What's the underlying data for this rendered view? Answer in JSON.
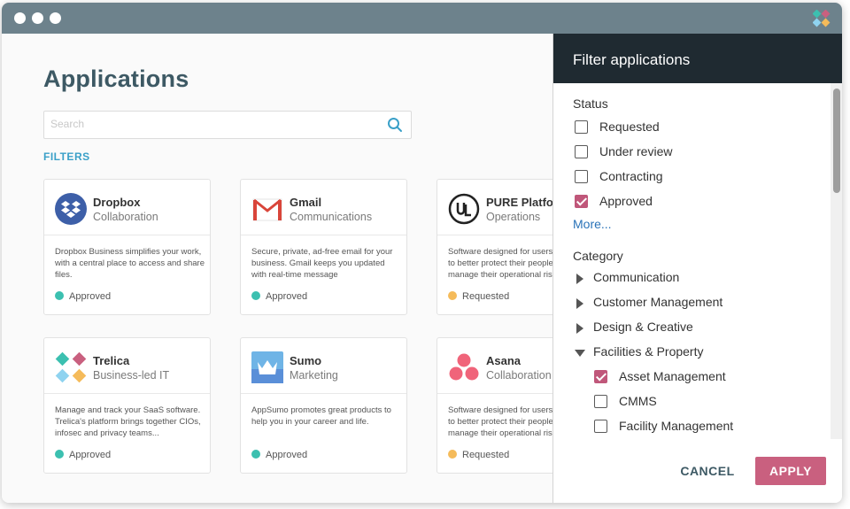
{
  "main": {
    "title": "Applications",
    "search_placeholder": "Search",
    "filters_label": "FILTERS"
  },
  "cards": [
    {
      "name": "Dropbox",
      "category": "Collaboration",
      "description": "Dropbox Business simplifies your work, with a central place to access and share files.",
      "status": "Approved",
      "status_color": "#3cc0b0",
      "icon": "dropbox-icon"
    },
    {
      "name": "Gmail",
      "category": "Communications",
      "description": "Secure, private, ad-free email for your business. Gmail keeps you updated with real-time message",
      "status": "Approved",
      "status_color": "#3cc0b0",
      "icon": "gmail-icon"
    },
    {
      "name": "PURE Platform",
      "category": "Operations",
      "description": "Software designed for users who want to better protect their people and manage their operational risk.",
      "status": "Requested",
      "status_color": "#f5bb5a",
      "icon": "ul-icon"
    },
    {
      "name": "Trelica",
      "category": "Business-led IT",
      "description": "Manage and track your SaaS software. Trelica's platform brings together CIOs, infosec and privacy teams...",
      "status": "Approved",
      "status_color": "#3cc0b0",
      "icon": "trelica-icon"
    },
    {
      "name": "Sumo",
      "category": "Marketing",
      "description": "AppSumo promotes great products to help you in your career and life.",
      "status": "Approved",
      "status_color": "#3cc0b0",
      "icon": "sumo-crown-icon"
    },
    {
      "name": "Asana",
      "category": "Collaboration",
      "description": "Software designed for users who want to better protect their people and manage their operational risk.",
      "status": "Requested",
      "status_color": "#f5bb5a",
      "icon": "asana-icon"
    }
  ],
  "panel": {
    "title": "Filter applications",
    "status_title": "Status",
    "status_options": [
      {
        "label": "Requested",
        "checked": false
      },
      {
        "label": "Under review",
        "checked": false
      },
      {
        "label": "Contracting",
        "checked": false
      },
      {
        "label": "Approved",
        "checked": true
      }
    ],
    "more_label": "More...",
    "category_title": "Category",
    "categories": [
      {
        "label": "Communication",
        "expanded": false
      },
      {
        "label": "Customer Management",
        "expanded": false
      },
      {
        "label": "Design & Creative",
        "expanded": false
      },
      {
        "label": "Facilities & Property",
        "expanded": true
      }
    ],
    "subcategories": [
      {
        "label": "Asset Management",
        "checked": true
      },
      {
        "label": "CMMS",
        "checked": false
      },
      {
        "label": "Facility Management",
        "checked": false
      }
    ],
    "cancel_label": "CANCEL",
    "apply_label": "APPLY"
  },
  "colors": {
    "titlebar": "#6d828c",
    "accent": "#c9607f",
    "panel_header": "#1f2a31",
    "link": "#2a73b8",
    "approved": "#3cc0b0",
    "requested": "#f5bb5a"
  }
}
